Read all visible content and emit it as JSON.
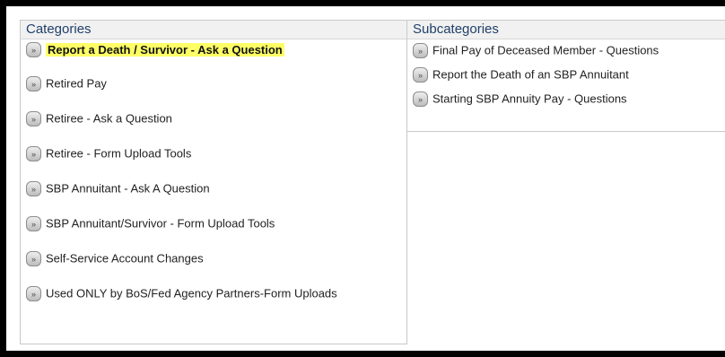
{
  "categories": {
    "header": "Categories",
    "items": [
      {
        "label": "Report a Death / Survivor - Ask a Question",
        "selected": true
      },
      {
        "label": "Retired Pay",
        "selected": false
      },
      {
        "label": "Retiree - Ask a Question",
        "selected": false
      },
      {
        "label": "Retiree - Form Upload Tools",
        "selected": false
      },
      {
        "label": "SBP Annuitant - Ask A Question",
        "selected": false
      },
      {
        "label": "SBP Annuitant/Survivor - Form Upload Tools",
        "selected": false
      },
      {
        "label": "Self-Service Account Changes",
        "selected": false
      },
      {
        "label": "Used ONLY by BoS/Fed Agency Partners-Form Uploads",
        "selected": false
      }
    ]
  },
  "subcategories": {
    "header": "Subcategories",
    "items": [
      {
        "label": "Final Pay of Deceased Member - Questions"
      },
      {
        "label": "Report the Death of an SBP Annuitant"
      },
      {
        "label": "Starting SBP Annuity Pay - Questions"
      }
    ]
  },
  "icons": {
    "arrow": "double-chevron-right-icon"
  },
  "colors": {
    "header_text": "#21406a",
    "highlight": "#ffff66",
    "frame": "#000000"
  }
}
